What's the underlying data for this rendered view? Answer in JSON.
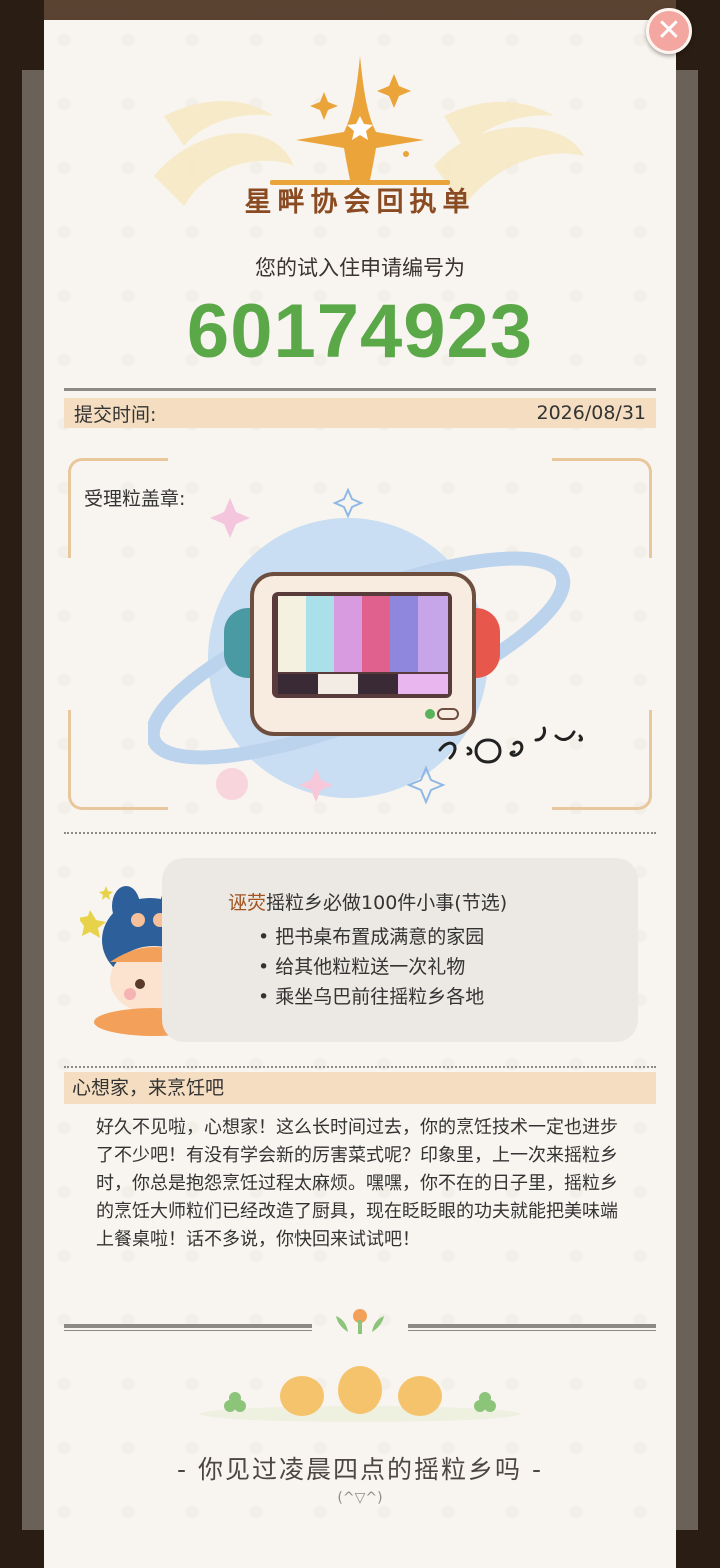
{
  "header": {
    "logo_title": "星畔协会回执单"
  },
  "receipt": {
    "subtitle": "您的试入住申请编号为",
    "application_number": "60174923",
    "submit_label": "提交时间:",
    "submit_date": "2026/08/31",
    "stamp_label": "受理粒盖章:"
  },
  "tips": {
    "title_accent": "诬荧",
    "title_rest": "摇粒乡必做100件小事(节选)",
    "items": [
      "• 把书桌布置成满意的家园",
      "• 给其他粒粒送一次礼物",
      "• 乘坐乌巴前往摇粒乡各地"
    ]
  },
  "letter": {
    "heading": "心想家，来烹饪吧",
    "body": "好久不见啦，心想家！这么长时间过去，你的烹饪技术一定也进步了不少吧！有没有学会新的厉害菜式呢？印象里，上一次来摇粒乡时，你总是抱怨烹饪过程太麻烦。嘿嘿，你不在的日子里，摇粒乡的烹饪大师粒们已经改造了厨具，现在眨眨眼的功夫就能把美味端上餐桌啦！话不多说，你快回来试试吧！"
  },
  "footer": {
    "tagline": "- 你见过凌晨四点的摇粒乡吗 -",
    "kaomoji": "(^▽^)"
  },
  "colors": {
    "number_green": "#5aa848",
    "band_peach": "#f4ddc0",
    "title_brown": "#8a4b22",
    "close_red": "#f3a7a0"
  }
}
